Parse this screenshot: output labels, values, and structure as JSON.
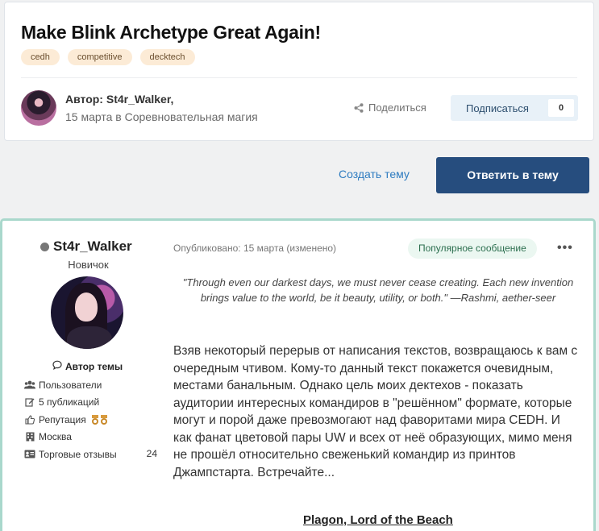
{
  "topic": {
    "title": "Make Blink Archetype Great Again!",
    "tags": [
      "cedh",
      "competitive",
      "decktech"
    ],
    "author_line": "Автор: St4r_Walker,",
    "date_line": "15 марта в Соревновательная магия",
    "share_label": "Поделиться",
    "follow_label": "Подписаться",
    "follow_count": "0"
  },
  "actions": {
    "create_topic": "Создать тему",
    "reply": "Ответить в тему"
  },
  "post": {
    "author_name": "St4r_Walker",
    "rank": "Новичок",
    "author_badge": "Автор темы",
    "stats": [
      {
        "icon": "users-icon",
        "label": "Пользователи",
        "count": ""
      },
      {
        "icon": "edit-icon",
        "label": "5 публикаций",
        "count": ""
      },
      {
        "icon": "thumbs-up-icon",
        "label": "Репутация",
        "count": ""
      },
      {
        "icon": "building-icon",
        "label": "Москва",
        "count": ""
      },
      {
        "icon": "id-card-icon",
        "label": "Торговые отзывы",
        "count": "24"
      }
    ],
    "meta": "Опубликовано: 15 марта (изменено)",
    "popular_badge": "Популярное сообщение",
    "more": "•••",
    "quote": "\"Through even our darkest days, we must never cease creating. Each new invention brings value to the world, be it beauty, utility, or both.\" —Rashmi, aether-seer",
    "body": "Взяв некоторый перерыв от написания текстов, возвращаюсь к вам с очередным чтивом. Кому-то данный текст покажется очевидным, местами банальным. Однако цель моих дектехов - показать аудитории интересных командиров в \"решённом\" формате, которые могут и порой даже превозмогают над фаворитами мира CEDH. И как фанат цветовой пары UW и всех от неё образующих, мимо меня не прошёл относительно свеженький командир из принтов Джампстарта. Встречайте...",
    "subheading": "Plagon, Lord of the Beach"
  },
  "colors": {
    "primary_button": "#264d7e",
    "link": "#2d7bc0",
    "tag_bg": "#fcebd6",
    "post_border": "#a9d8cc",
    "popular_bg": "#ebf7f1"
  }
}
